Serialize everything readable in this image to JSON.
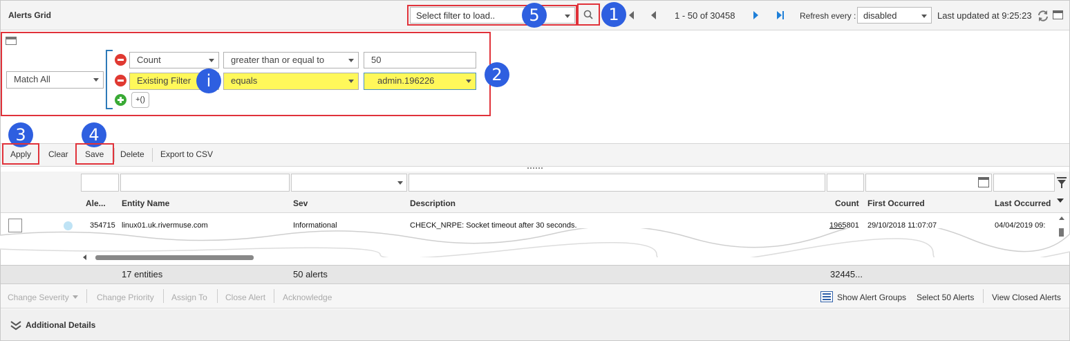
{
  "header": {
    "title": "Alerts Grid",
    "filter_select_placeholder": "Select filter to load..",
    "pager_text": "1 - 50 of 30458",
    "refresh_label": "Refresh every :",
    "refresh_value": "disabled",
    "last_updated": "Last updated at 9:25:23"
  },
  "badges": {
    "b1": "1",
    "b2": "2",
    "b3": "3",
    "b4": "4",
    "b5": "5",
    "info": "i"
  },
  "filter": {
    "match_mode": "Match All",
    "rows": [
      {
        "field": "Count",
        "operator": "greater than or equal to",
        "value": "50"
      },
      {
        "field": "Existing Filter",
        "operator": "equals",
        "value": "admin.196226"
      }
    ],
    "add_group_label": "+()"
  },
  "toolbar": {
    "apply": "Apply",
    "clear": "Clear",
    "save": "Save",
    "delete": "Delete",
    "export": "Export to CSV"
  },
  "grid": {
    "columns": [
      "Ale...",
      "Entity Name",
      "Sev",
      "Description",
      "Count",
      "First Occurred",
      "Last Occurred"
    ],
    "rows": [
      {
        "alert_id": "354715",
        "entity": "linux01.uk.rivermuse.com",
        "severity": "Informational",
        "description": "CHECK_NRPE: Socket timeout after 30 seconds.",
        "count": "1965801",
        "first": "29/10/2018 11:07:07",
        "last": "04/04/2019 09:"
      }
    ],
    "summary": {
      "entities": "17 entities",
      "alerts": "50 alerts",
      "count": "32445..."
    }
  },
  "actions": {
    "change_severity": "Change Severity",
    "change_priority": "Change Priority",
    "assign_to": "Assign To",
    "close_alert": "Close Alert",
    "acknowledge": "Acknowledge",
    "show_alert_groups": "Show Alert Groups",
    "select_alerts": "Select 50 Alerts",
    "view_closed": "View Closed Alerts"
  },
  "details": {
    "title": "Additional Details"
  },
  "colors": {
    "annotation_red": "#e0323a",
    "badge_blue": "#2e5fe0",
    "highlight_yellow": "#fff85a",
    "minus_red": "#e03a32",
    "plus_green": "#3aaa35",
    "pager_blue": "#1e7fd8"
  },
  "icons": [
    "search-icon",
    "first-page-icon",
    "prev-page-icon",
    "next-page-icon",
    "last-page-icon",
    "refresh-icon",
    "maximize-icon",
    "panel-toggle-icon",
    "remove-rule-icon",
    "add-rule-icon",
    "calendar-icon",
    "column-filter-icon",
    "alert-groups-icon",
    "expand-details-icon"
  ]
}
